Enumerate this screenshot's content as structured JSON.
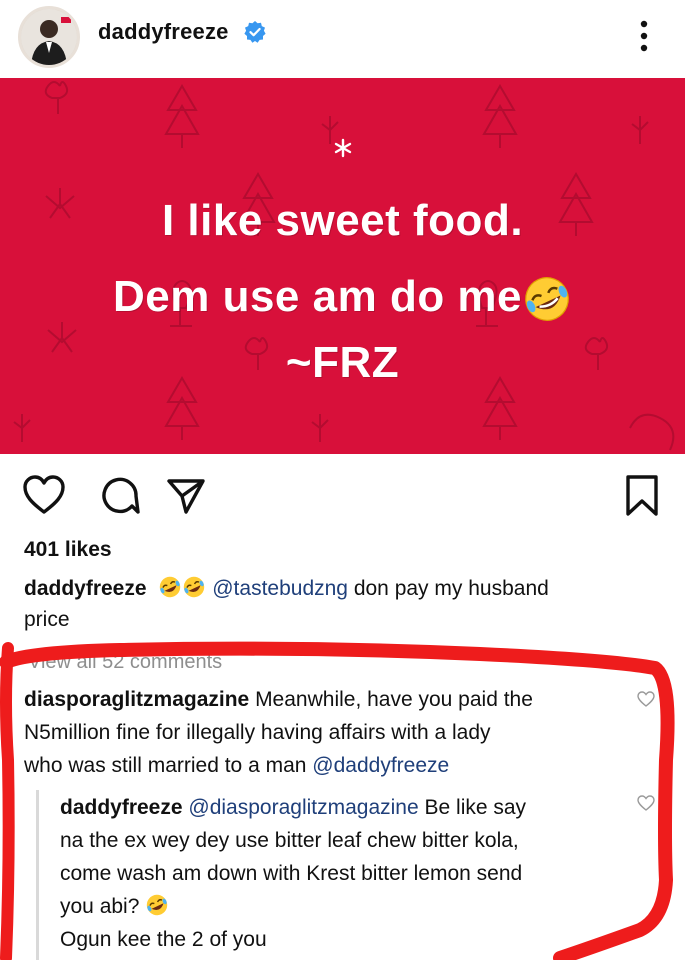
{
  "header": {
    "username": "daddyfreeze",
    "verified_icon": "verified-badge-icon",
    "more_icon": "more-vertical-icon"
  },
  "post": {
    "background_color": "#d8103a",
    "line1": "I like sweet food.",
    "line2": "Dem use am do me",
    "line3": "~FRZ",
    "emoji": "rolling-on-floor-laughing-emoji"
  },
  "actions": {
    "like_icon": "heart-icon",
    "comment_icon": "comment-icon",
    "share_icon": "share-icon",
    "save_icon": "bookmark-icon"
  },
  "likes": "401 likes",
  "caption": {
    "user": "daddyfreeze",
    "mention": "@tastebudzng",
    "text_line1": "don pay my husband",
    "text_line2": "price"
  },
  "view_all_comments": "View all 52 comments",
  "comments": [
    {
      "user": "diasporaglitzmagazine",
      "text1": "Meanwhile, have you paid the",
      "text2": "N5million fine for illegally having affairs with a lady",
      "text3": "who was still married to a man",
      "mention": "@daddyfreeze"
    }
  ],
  "reply": {
    "user": "daddyfreeze",
    "mention": "@diasporaglitzmagazine",
    "text1": "Be like say",
    "text2": "na the ex wey dey use bitter leaf chew bitter kola,",
    "text3": "come wash am down with Krest bitter lemon send",
    "text4": "you abi?",
    "text5": "Ogun kee the 2 of you"
  },
  "annotation_color": "#ee1c1c"
}
